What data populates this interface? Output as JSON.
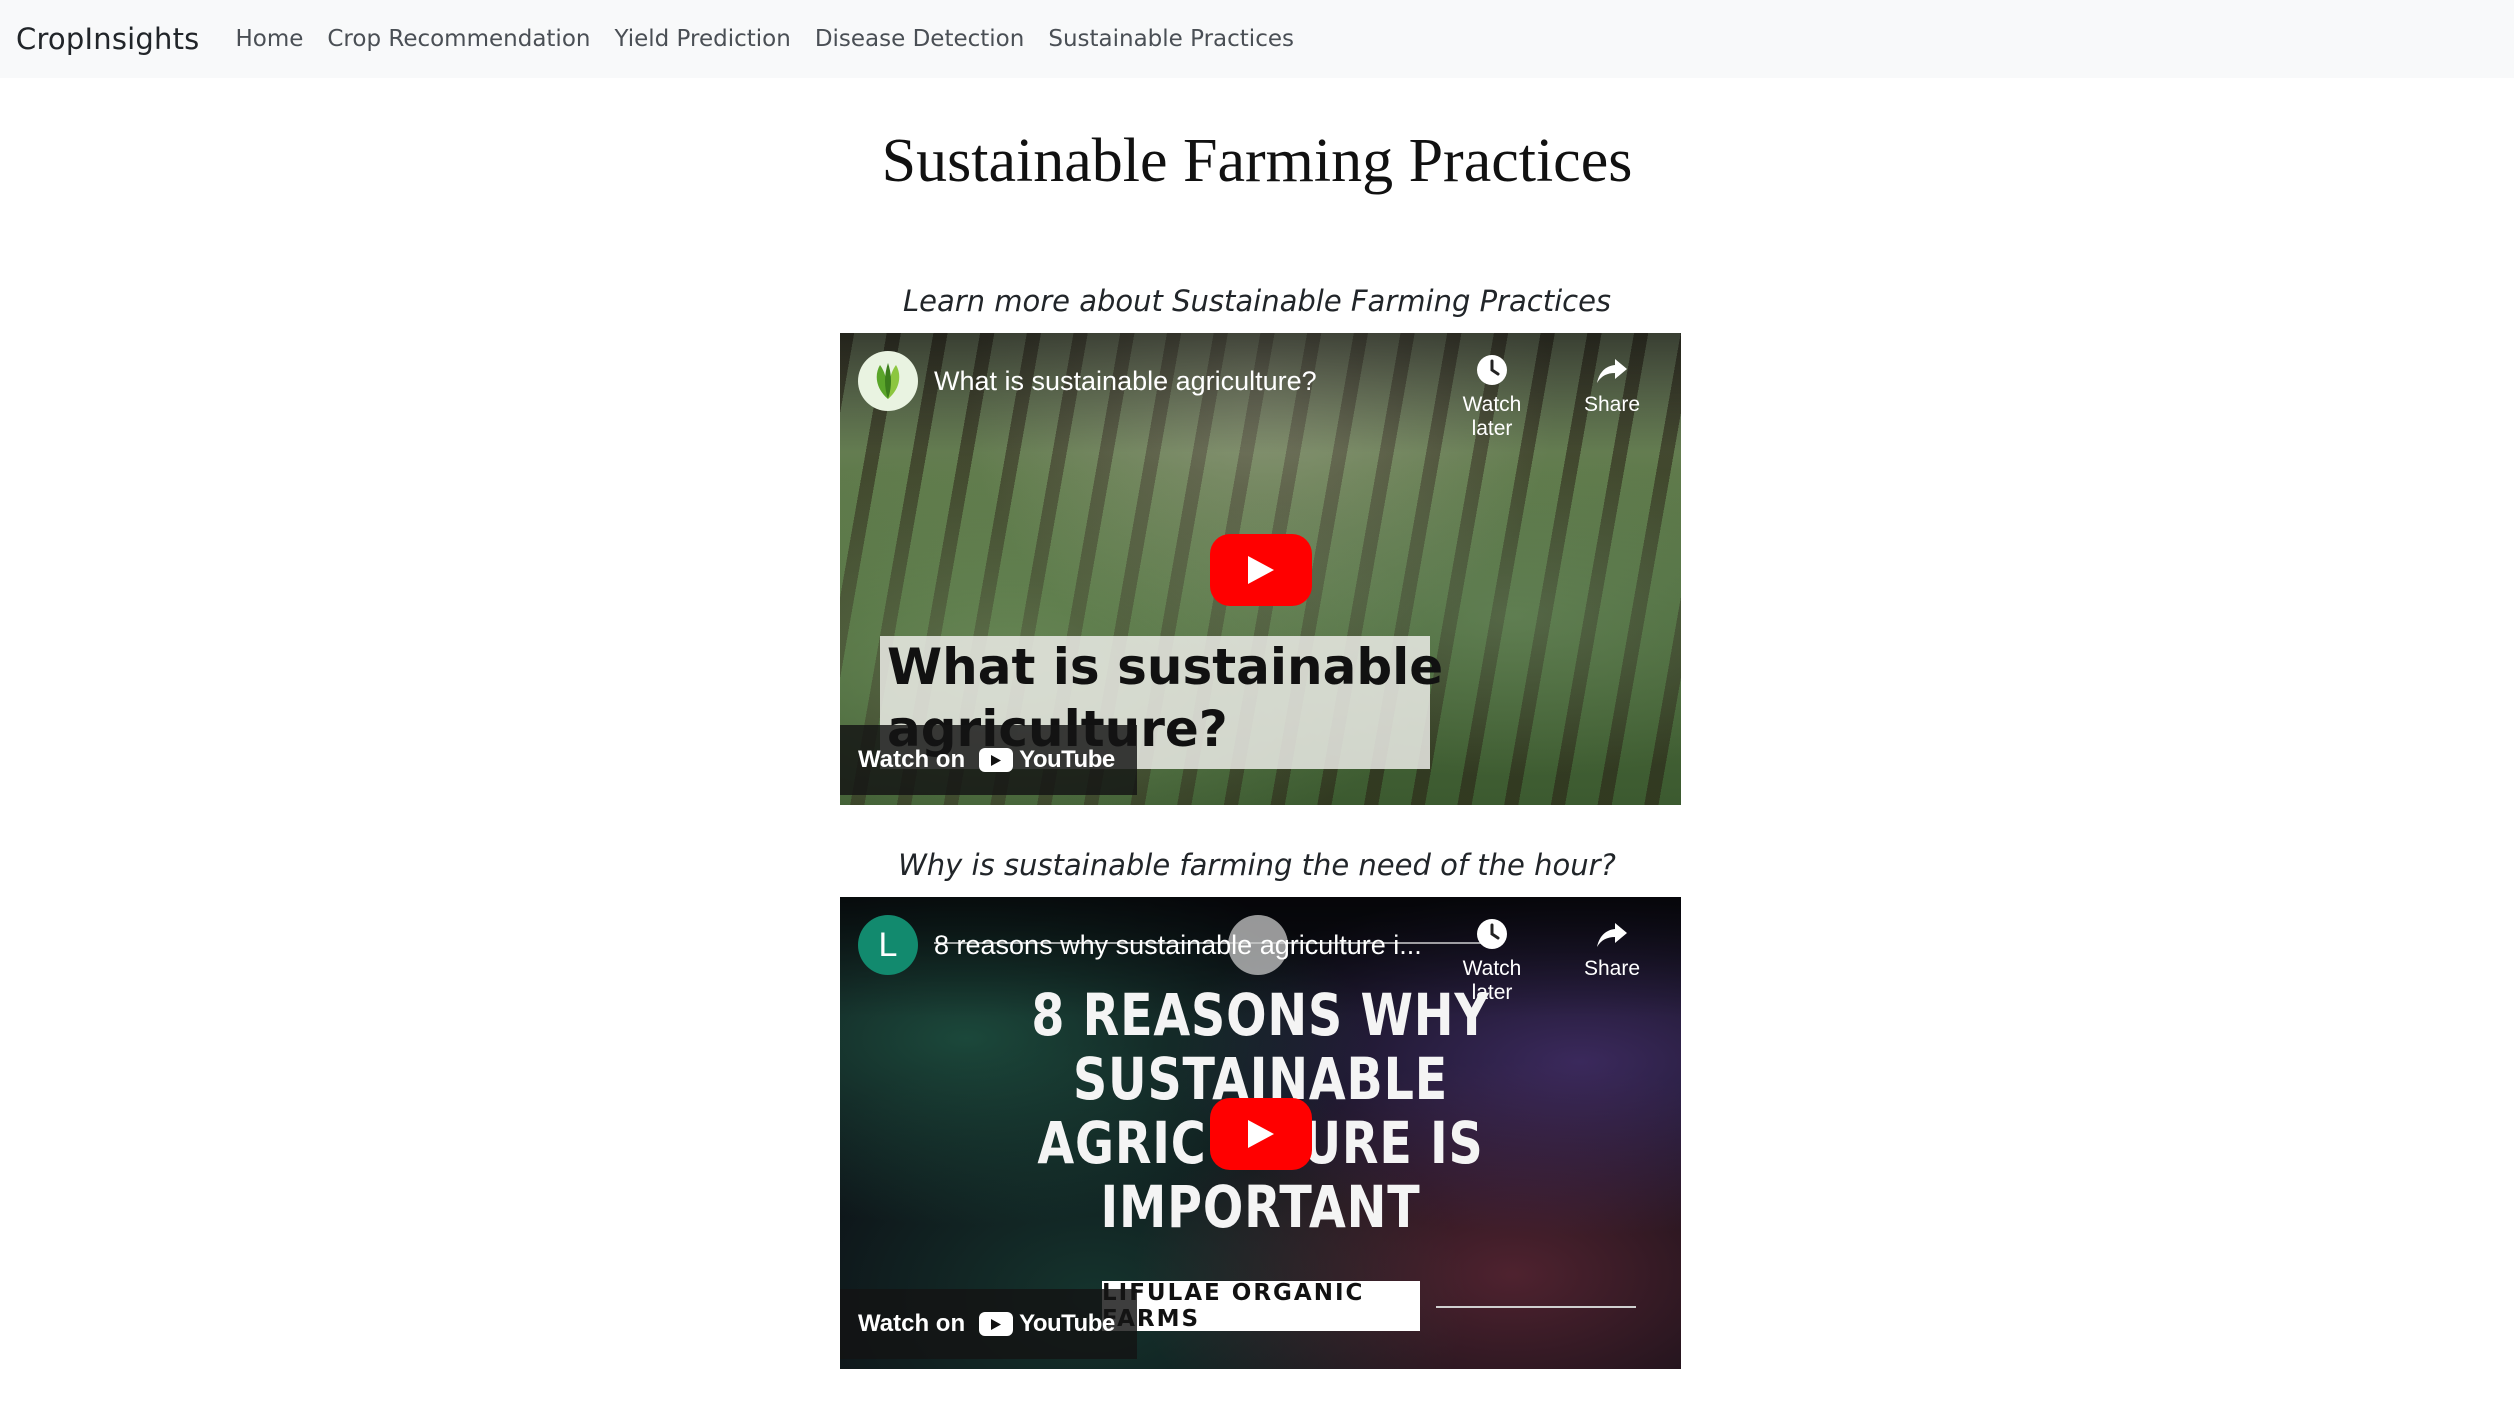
{
  "navbar": {
    "brand": "CropInsights",
    "links": [
      "Home",
      "Crop Recommendation",
      "Yield Prediction",
      "Disease Detection",
      "Sustainable Practices"
    ]
  },
  "page": {
    "title": "Sustainable Farming Practices"
  },
  "sections": [
    {
      "heading": "Learn more about Sustainable Farming Practices",
      "video": {
        "title": "What is sustainable agriculture?",
        "watch_later": "Watch later",
        "share": "Share",
        "overlay_line1": "What is sustainable",
        "overlay_line2": "agriculture?",
        "watch_on": "Watch on",
        "youtube": "YouTube"
      }
    },
    {
      "heading": "Why is sustainable farming the need of the hour?",
      "video": {
        "channel_initial": "L",
        "title": "8 reasons why sustainable agriculture i...",
        "watch_later": "Watch later",
        "share": "Share",
        "thumb_line1": "8 REASONS WHY",
        "thumb_line2": "SUSTAINABLE",
        "thumb_line3": "AGRICULTURE IS",
        "thumb_line4": "IMPORTANT",
        "brand_label": "LIFULAE ORGANIC FARMS",
        "watch_on": "Watch on",
        "youtube": "YouTube"
      }
    }
  ],
  "icons": {
    "play": "play-icon",
    "clock": "clock-icon",
    "share": "share-arrow-icon",
    "youtube": "youtube-logo-icon",
    "leaf": "leaf-logo-icon"
  },
  "colors": {
    "navbar_bg": "#f8f9fa",
    "play_red": "#ff0000",
    "channel_green": "#128a6e"
  }
}
